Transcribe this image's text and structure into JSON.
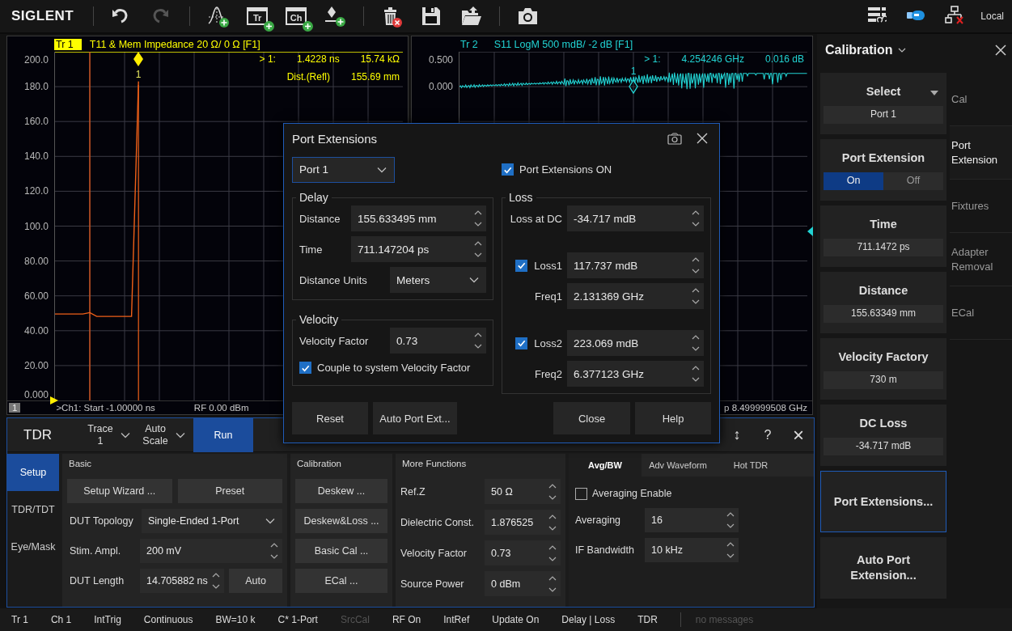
{
  "toolbar": {
    "logo": "SIGLENT",
    "tools": [
      {
        "kind": "undo",
        "disabled": false
      },
      {
        "kind": "redo",
        "disabled": true
      },
      {
        "kind": "curve-add",
        "disabled": false
      },
      {
        "kind": "trace-add",
        "label": "Tr",
        "disabled": false
      },
      {
        "kind": "channel-add",
        "label": "Ch",
        "disabled": false
      },
      {
        "kind": "marker-add",
        "disabled": false
      },
      {
        "kind": "delete",
        "disabled": false
      },
      {
        "kind": "save",
        "disabled": false
      },
      {
        "kind": "open",
        "disabled": false
      },
      {
        "kind": "camera",
        "disabled": false
      }
    ],
    "status_icons": [
      {
        "kind": "layout"
      },
      {
        "kind": "usb"
      },
      {
        "kind": "network"
      }
    ],
    "mode": "Local"
  },
  "charts": [
    {
      "kind": "tdr",
      "active": true,
      "color": "#ffff00",
      "trace_tag": "Tr 1",
      "title": "T11 & Mem  Impedance  20 Ω/  0 Ω  [F1]",
      "chart_data": {
        "type": "line",
        "grid": true,
        "ylim": [
          0,
          200
        ],
        "yticks": [
          {
            "value": 200,
            "label": "200.0"
          },
          {
            "value": 180,
            "label": "180.0"
          },
          {
            "value": 160,
            "label": "160.0"
          },
          {
            "value": 140,
            "label": "140.0"
          },
          {
            "value": 120,
            "label": "120.0"
          },
          {
            "value": 100,
            "label": "100.0"
          },
          {
            "value": 80,
            "label": "80.00"
          },
          {
            "value": 60,
            "label": "60.00"
          },
          {
            "value": 40,
            "label": "40.00"
          },
          {
            "value": 20,
            "label": "20.00"
          },
          {
            "value": 0,
            "label": "0.000"
          }
        ],
        "categories": [
          null,
          null,
          null,
          null,
          null,
          null,
          null,
          null,
          null,
          null,
          null,
          null,
          null,
          null,
          null,
          null,
          null,
          null,
          null,
          null,
          null,
          null,
          null,
          null,
          null,
          null,
          null,
          null,
          null,
          null,
          null,
          null,
          null,
          null,
          null,
          null,
          null,
          null,
          null,
          null,
          null,
          null,
          null,
          null,
          null,
          null,
          null,
          null,
          null,
          null,
          null
        ],
        "series": [
          {
            "color": "#f06018",
            "values": [
              49.6,
              49.6,
              49.6,
              49.6,
              49.6,
              50.4,
              48.2,
              48.2,
              48.2,
              48.2,
              48.2,
              48.2,
              183,
              null,
              null,
              null,
              null,
              null,
              null,
              null,
              null,
              null,
              null,
              null,
              null,
              null,
              null,
              null,
              null,
              null,
              null,
              null,
              null,
              null,
              null,
              null,
              null,
              null,
              null,
              null,
              null,
              null,
              null,
              null,
              null,
              null,
              null,
              null,
              null,
              null,
              null
            ]
          }
        ]
      },
      "marker_label": "1",
      "readout": [
        [
          "> 1:",
          "1.4228 ns",
          "15.74 kΩ"
        ],
        [
          "Dist.(Refl)",
          "155.69 mm"
        ]
      ],
      "footer": {
        "badge": "1",
        "start": ">Ch1: Start -1.00000 ns",
        "power": "RF 0.00 dBm"
      }
    },
    {
      "kind": "sparam",
      "active": false,
      "color": "#22d3d3",
      "trace_tag": "Tr 2",
      "title": "S11  LogM  500 mdB/  -2 dB  [F1]",
      "y_ticks": [
        "0.500",
        "0.000"
      ],
      "marker_label": "1",
      "readout": [
        [
          "> 1:",
          "4.254246 GHz",
          "0.016 dB"
        ]
      ],
      "footer": {
        "stop": "p 8.499999508 GHz"
      }
    }
  ],
  "tdr_panel": {
    "title": "TDR",
    "header_controls": [
      {
        "kind": "dropdown",
        "text": "Trace 1"
      },
      {
        "kind": "dropdown",
        "text": "Auto Scale"
      },
      {
        "kind": "button",
        "text": "Run"
      }
    ],
    "window_buttons": [
      {
        "kind": "resize",
        "text": "↕"
      },
      {
        "kind": "help",
        "text": "?"
      },
      {
        "kind": "close",
        "text": "×"
      }
    ],
    "side_tabs": [
      {
        "label": "Setup",
        "selected": true
      },
      {
        "label": "TDR/TDT",
        "selected": false
      },
      {
        "label": "Eye/Mask",
        "selected": false
      }
    ],
    "basic": {
      "title": "Basic",
      "buttons": [
        "Setup Wizard ...",
        "Preset"
      ],
      "rows": [
        {
          "label": "DUT Topology",
          "kind": "dropdown",
          "value": "Single-Ended 1-Port"
        },
        {
          "label": "Stim. Ampl.",
          "kind": "spin",
          "value": "200 mV"
        },
        {
          "label": "DUT Length",
          "kind": "spin-button",
          "value": "14.705882 ns",
          "button": "Auto"
        }
      ]
    },
    "calibration": {
      "title": "Calibration",
      "buttons": [
        "Deskew ...",
        "Deskew&Loss ...",
        "Basic Cal ...",
        "ECal ..."
      ]
    },
    "more_functions": {
      "title": "More Functions",
      "rows": [
        {
          "label": "Ref.Z",
          "value": "50 Ω"
        },
        {
          "label": "Dielectric Const.",
          "value": "1.876525"
        },
        {
          "label": "Velocity Factor",
          "value": "0.73"
        },
        {
          "label": "Source Power",
          "value": "0 dBm"
        }
      ]
    },
    "avg_tabs": [
      {
        "label": "Avg/BW",
        "selected": true
      },
      {
        "label": "Adv Waveform",
        "selected": false
      },
      {
        "label": "Hot TDR",
        "selected": false
      }
    ],
    "averaging_enable": {
      "label": "Averaging Enable",
      "checked": false
    },
    "avg_rows": [
      {
        "label": "Averaging",
        "value": "16"
      },
      {
        "label": "IF Bandwidth",
        "value": "10 kHz"
      }
    ]
  },
  "calibration_panel": {
    "title": "Calibration",
    "softkeys": [
      {
        "kind": "select",
        "title": "Select",
        "value": "Port 1"
      },
      {
        "kind": "toggle",
        "title": "Port Extension",
        "options": [
          {
            "label": "On",
            "selected": true
          },
          {
            "label": "Off",
            "selected": false
          }
        ]
      },
      {
        "kind": "value",
        "title": "Time",
        "value": "711.1472 ps"
      },
      {
        "kind": "value",
        "title": "Distance",
        "value": "155.63349 mm"
      },
      {
        "kind": "value",
        "title": "Velocity Factory",
        "value": "730 m"
      },
      {
        "kind": "value",
        "title": "DC Loss",
        "value": "-34.717 mdB"
      },
      {
        "kind": "action",
        "title": "Port Extensions...",
        "highlighted": true
      },
      {
        "kind": "action",
        "title": "Auto Port Extension...",
        "highlighted": false
      }
    ],
    "tabs": [
      {
        "label": "Cal",
        "selected": false
      },
      {
        "label": "Port Extension",
        "selected": true
      },
      {
        "label": "Fixtures",
        "selected": false
      },
      {
        "label": "Adapter Removal",
        "selected": false
      },
      {
        "label": "ECal",
        "selected": false
      }
    ]
  },
  "dialog": {
    "title": "Port Extensions",
    "port": "Port 1",
    "enable": {
      "label": "Port Extensions ON",
      "checked": true
    },
    "delay": {
      "title": "Delay",
      "rows": [
        {
          "label": "Distance",
          "kind": "spin",
          "value": "155.633495 mm"
        },
        {
          "label": "Time",
          "kind": "spin",
          "value": "711.147204 ps"
        },
        {
          "label": "Distance Units",
          "kind": "dropdown",
          "value": "Meters"
        }
      ]
    },
    "velocity": {
      "title": "Velocity",
      "factor_label": "Velocity Factor",
      "factor": "0.73",
      "couple": {
        "label": "Couple to system Velocity Factor",
        "checked": true
      }
    },
    "loss": {
      "title": "Loss",
      "dc_label": "Loss at DC",
      "dc": "-34.717 mdB",
      "terms": [
        {
          "loss_label": "Loss1",
          "checked": true,
          "loss": "117.737 mdB",
          "freq_label": "Freq1",
          "freq": "2.131369 GHz"
        },
        {
          "loss_label": "Loss2",
          "checked": true,
          "loss": "223.069 mdB",
          "freq_label": "Freq2",
          "freq": "6.377123 GHz"
        }
      ]
    },
    "buttons": [
      "Reset",
      "Auto Port Ext...",
      "Close",
      "Help"
    ]
  },
  "status_bar": [
    {
      "text": "Tr 1",
      "disabled": false
    },
    {
      "text": "Ch 1",
      "disabled": false
    },
    {
      "text": "IntTrig",
      "disabled": false
    },
    {
      "text": "Continuous",
      "disabled": false
    },
    {
      "text": "BW=10 k",
      "disabled": false
    },
    {
      "text": "C* 1-Port",
      "disabled": false
    },
    {
      "text": "SrcCal",
      "disabled": true
    },
    {
      "text": "RF On",
      "disabled": false
    },
    {
      "text": "IntRef",
      "disabled": false
    },
    {
      "text": "Update On",
      "disabled": false
    },
    {
      "text": "Delay | Loss",
      "disabled": false
    },
    {
      "text": "TDR",
      "disabled": false
    },
    {
      "text": "no messages",
      "disabled": true
    }
  ]
}
